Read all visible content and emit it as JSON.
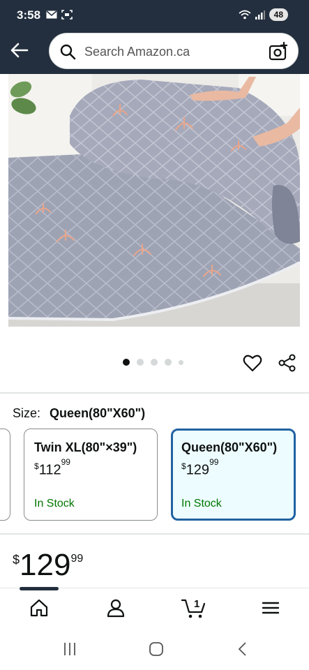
{
  "status_bar": {
    "time": "3:58",
    "battery": "48"
  },
  "header": {
    "search_placeholder": "Search Amazon.ca"
  },
  "product": {
    "image_alt": "mattress topper",
    "carousel": {
      "total": 5,
      "active_index": 0
    }
  },
  "size_section": {
    "label": "Size:",
    "selected": "Queen(80\"X60\")",
    "options": [
      {
        "title": "Twin XL(80\"×39\")",
        "currency": "$",
        "price_whole": "112",
        "price_fraction": "99",
        "stock": "In Stock"
      },
      {
        "title": "Queen(80\"X60\")",
        "currency": "$",
        "price_whole": "129",
        "price_fraction": "99",
        "stock": "In Stock"
      }
    ]
  },
  "price": {
    "currency": "$",
    "whole": "129",
    "fraction": "99"
  },
  "bottom_nav": {
    "cart_count": "1"
  },
  "colors": {
    "header_bg": "#232f3e",
    "selected_border": "#2162a1",
    "selected_bg": "#edfdff",
    "in_stock": "#007600"
  }
}
